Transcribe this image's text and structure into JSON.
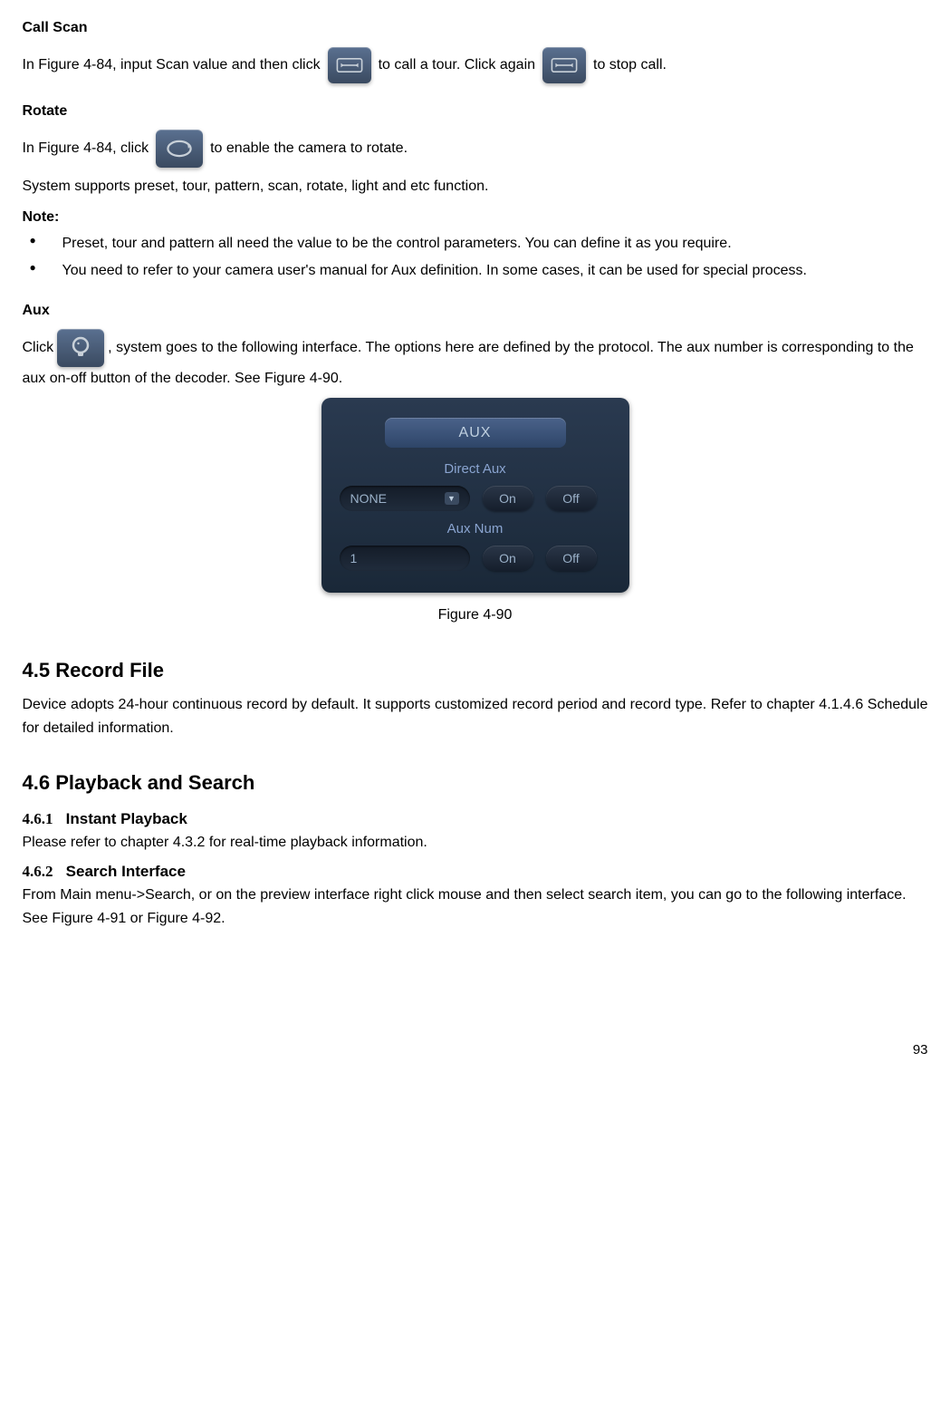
{
  "headings": {
    "call_scan": "Call Scan",
    "rotate": "Rotate",
    "note": "Note:",
    "aux": "Aux",
    "record_file": "4.5  Record File",
    "playback_search": "4.6  Playback and Search",
    "instant_playback_num": "4.6.1",
    "instant_playback": "Instant Playback",
    "search_interface_num": "4.6.2",
    "search_interface": "Search Interface"
  },
  "text": {
    "scan_1": "In Figure 4-84, input Scan value and then click ",
    "scan_2": " to call a tour. Click again ",
    "scan_3": " to stop call.",
    "rotate_1": "In Figure 4-84, click ",
    "rotate_2": " to enable the camera to rotate.",
    "rotate_support": "System supports preset, tour, pattern, scan, rotate, light and etc function.",
    "note_b1": "Preset, tour and pattern all need the value to be the control parameters. You can define it as you require.",
    "note_b2": "You need to refer to your camera user's manual for Aux definition. In some cases, it can be used for special process.",
    "aux_p1a": "Click",
    "aux_p1b": ", system goes to the following interface. The options here are defined by the protocol. The aux number is corresponding to the aux on-off button of the decoder. See Figure 4-90.",
    "record_file_body": "Device adopts 24-hour continuous record by default. It supports customized record period and record type. Refer to chapter 4.1.4.6 Schedule for detailed information.",
    "instant_body": "Please refer to chapter 4.3.2 for real-time playback information.",
    "search_body": "From Main menu->Search, or on the preview interface right click mouse and then select search item, you can go to the following interface. See Figure 4-91 or Figure 4-92."
  },
  "aux_panel": {
    "title": "AUX",
    "direct_aux_label": "Direct Aux",
    "direct_aux_value": "NONE",
    "aux_num_label": "Aux Num",
    "aux_num_value": "1",
    "on": "On",
    "off": "Off"
  },
  "figure_caption": "Figure 4-90",
  "page_number": "93"
}
